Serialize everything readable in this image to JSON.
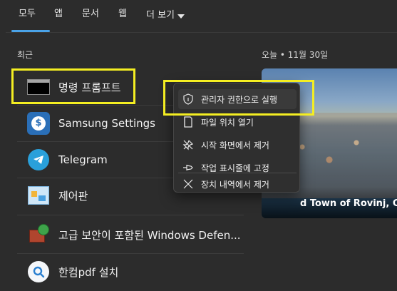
{
  "tabs": {
    "all": "모두",
    "apps": "앱",
    "documents": "문서",
    "web": "웹",
    "more": "더 보기"
  },
  "recent": {
    "title": "최근",
    "items": [
      {
        "label": "명령 프롬프트",
        "icon": "command-prompt-icon"
      },
      {
        "label": "Samsung Settings",
        "icon": "samsung-settings-icon"
      },
      {
        "label": "Telegram",
        "icon": "telegram-icon"
      },
      {
        "label": "제어판",
        "icon": "control-panel-icon"
      },
      {
        "label": "고급 보안이 포함된 Windows Defen...",
        "icon": "windows-defender-firewall-icon"
      },
      {
        "label": "한컴pdf 설치",
        "icon": "hancom-pdf-icon"
      }
    ]
  },
  "context_menu": {
    "items": [
      {
        "label": "관리자 권한으로 실행",
        "icon": "shield-icon"
      },
      {
        "label": "파일 위치 열기",
        "icon": "folder-icon"
      },
      {
        "label": "시작 화면에서 제거",
        "icon": "unpin-icon"
      },
      {
        "label": "작업 표시줄에 고정",
        "icon": "pin-icon"
      },
      {
        "label": "장치 내역에서 제거",
        "icon": "close-icon"
      }
    ]
  },
  "today": {
    "date": "오늘 • 11월 30일",
    "caption": "d Town of Rovinj, Cr"
  },
  "colors": {
    "accent": "#4aa3e8",
    "highlight": "#f4ee22"
  }
}
